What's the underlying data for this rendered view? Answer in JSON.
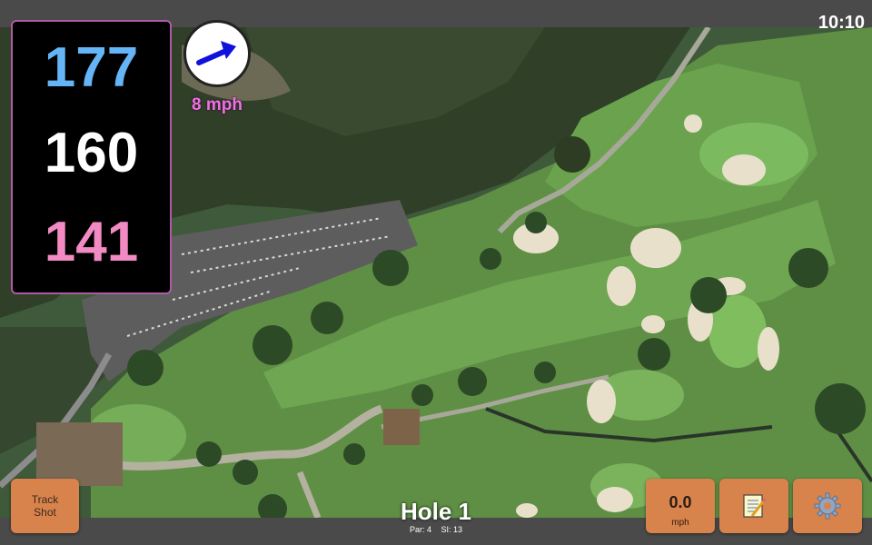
{
  "status": {
    "time": "10:10"
  },
  "distances": {
    "back": "177",
    "center": "160",
    "front": "141"
  },
  "wind": {
    "speed": "8 mph",
    "icon": "wind-arrow-icon"
  },
  "hole": {
    "title": "Hole 1",
    "par": "Par: 4",
    "stroke_index": "SI: 13"
  },
  "buttons": {
    "track_shot": {
      "line1": "Track",
      "line2": "Shot"
    },
    "speed": {
      "value": "0.0",
      "unit": "mph"
    },
    "notes_icon": "notepad-icon",
    "settings_icon": "gear-icon"
  },
  "colors": {
    "back": "#64b4f6",
    "center": "#ffffff",
    "front": "#f28bc4",
    "button": "#d9834c",
    "wind_text": "#f070e0"
  }
}
